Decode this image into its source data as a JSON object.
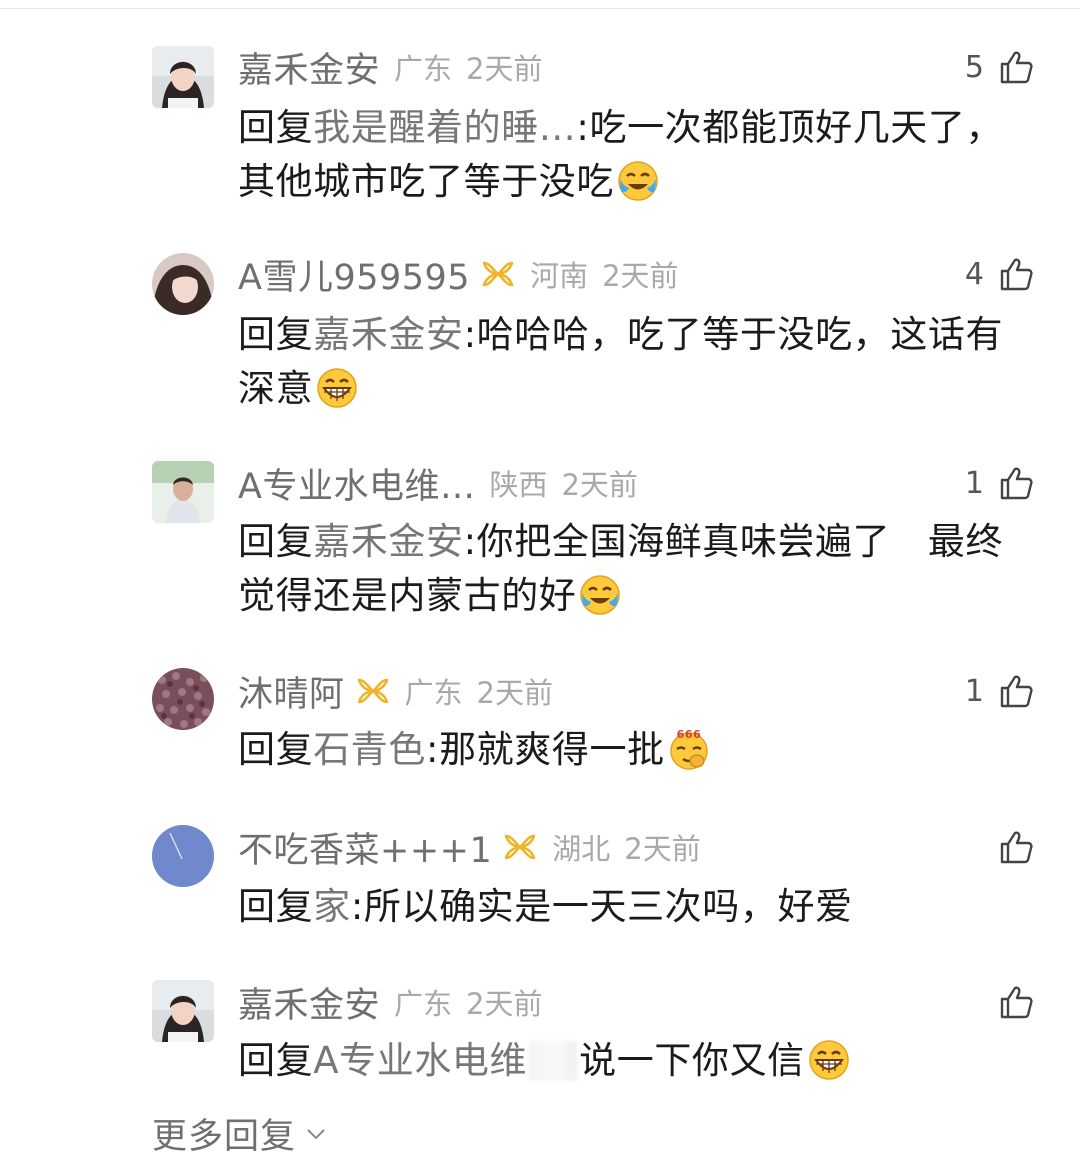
{
  "replies": [
    {
      "name": "嘉禾金安",
      "vip": false,
      "location": "广东",
      "time": "2天前",
      "likes": "5",
      "reply_label": "回复",
      "target": "我是醒着的睡…",
      "text": ":吃一次都能顶好几天了，其他城市吃了等于没吃",
      "emoji": "laugh-cry-emoji",
      "avatar": "woman-photo"
    },
    {
      "name": "A雪儿959595",
      "vip": true,
      "location": "河南",
      "time": "2天前",
      "likes": "4",
      "reply_label": "回复",
      "target": "嘉禾金安",
      "text": ":哈哈哈，吃了等于没吃，这话有深意",
      "emoji": "grin-emoji",
      "avatar": "woman-selfie"
    },
    {
      "name": "A专业水电维…",
      "vip": false,
      "location": "陕西",
      "time": "2天前",
      "likes": "1",
      "reply_label": "回复",
      "target": "嘉禾金安",
      "text": ":你把全国海鲜真味尝遍了　最终觉得还是内蒙古的好",
      "emoji": "laugh-cry-emoji",
      "avatar": "man-photo"
    },
    {
      "name": "沐晴阿",
      "vip": true,
      "location": "广东",
      "time": "2天前",
      "likes": "1",
      "reply_label": "回复",
      "target": "石青色",
      "text": ":那就爽得一批",
      "emoji": "666-emoji",
      "emoji_text": "666",
      "avatar": "texture-photo"
    },
    {
      "name": "不吃香菜+++1",
      "vip": true,
      "location": "湖北",
      "time": "2天前",
      "likes": "",
      "reply_label": "回复",
      "target": "家",
      "text": ":所以确实是一天三次吗，好爱",
      "emoji": "",
      "avatar": "blue-circle"
    },
    {
      "name": "嘉禾金安",
      "vip": false,
      "location": "广东",
      "time": "2天前",
      "likes": "",
      "reply_label": "回复",
      "target": "A专业水电维",
      "text": "说一下你又信",
      "emoji": "grin-emoji",
      "avatar": "woman-photo"
    }
  ],
  "more_replies": "更多回复",
  "colors": {
    "name": "#6f6f6f",
    "meta": "#a9a9a9",
    "body": "#1b1b1b",
    "vip_gold": "#f0b429"
  }
}
